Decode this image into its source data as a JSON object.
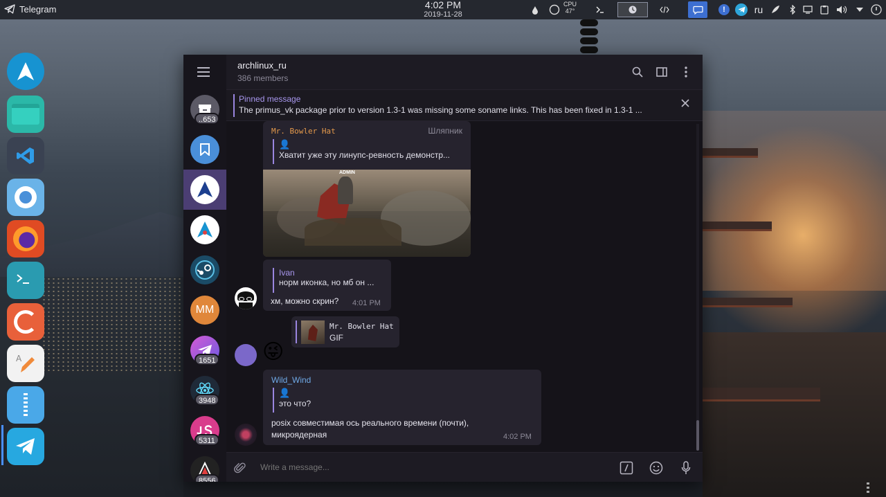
{
  "topbar": {
    "app_name": "Telegram",
    "time": "4:02 PM",
    "date": "2019-11-28",
    "cpu_label": "CPU",
    "cpu_temp": "47°",
    "keyboard_layout": "ru",
    "accent": "#3d6fd1"
  },
  "dock": {
    "items": [
      "arch-linux-icon",
      "files-icon",
      "vscode-icon",
      "chromium-icon",
      "firefox-icon",
      "terminal-icon",
      "gnome-software-icon",
      "text-editor-icon",
      "archive-manager-icon",
      "telegram-icon"
    ]
  },
  "chat": {
    "title": "archlinux_ru",
    "members": "386 members",
    "pinned_title": "Pinned message",
    "pinned_text": "The primus_vk package prior to version 1.3-1 was missing some soname links. This has been fixed in 1.3-1 ...",
    "composer_placeholder": "Write a message..."
  },
  "chat_list": [
    {
      "name": "chat-1",
      "badge": "..653",
      "color": "#5c5a66"
    },
    {
      "name": "saved-messages",
      "badge": "",
      "color": "#4a8fd9"
    },
    {
      "name": "archlinux-ru",
      "badge": "",
      "color": "#ffffff"
    },
    {
      "name": "archlinux-chat-2",
      "badge": "",
      "color": "#ffffff"
    },
    {
      "name": "steam-chat",
      "badge": "",
      "color": "#2e7ea0"
    },
    {
      "name": "mm-chat",
      "initials": "MM",
      "badge": "",
      "color": "#e0873a"
    },
    {
      "name": "telegram-chat",
      "badge": "1651",
      "color": "#9b5ad6"
    },
    {
      "name": "react-chat",
      "badge": "3948",
      "color": "#1f2a38"
    },
    {
      "name": "js-chat",
      "badge": "5311",
      "color": "#d93c8c"
    },
    {
      "name": "arch-chat-3",
      "badge": "8556",
      "color": "#2a2a2a"
    }
  ],
  "messages": {
    "m1": {
      "sender": "Mr. Bowler Hat",
      "sender_title": "Шляпник",
      "reply_text": "Хватит уже эту линупс-ревность демонстр...",
      "image_caption": "ADMIN"
    },
    "m2": {
      "reply_sender": "Ivan",
      "reply_text": "норм иконка, но мб он ...",
      "text": "хм, можно скрин?",
      "time": "4:01 PM"
    },
    "m3": {
      "reply_sender": "Mr. Bowler Hat",
      "reply_text": "GIF",
      "emoji": "😜"
    },
    "m4": {
      "sender": "Wild_Wind",
      "reply_text": "это что?",
      "text_line1": "posix совместимая ось реального времени (почти),",
      "text_line2": "микроядерная",
      "time": "4:02 PM"
    }
  },
  "colors": {
    "accent_purple": "#9a86e0",
    "sender_orange": "#e59a4c",
    "sender_blue": "#6fa9e6",
    "active_chat": "#4b3e73"
  }
}
